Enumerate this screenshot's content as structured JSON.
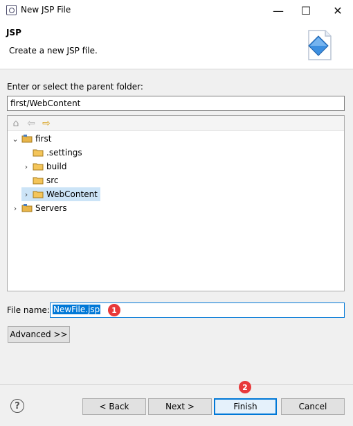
{
  "window": {
    "title": "New JSP File",
    "minimize": "—",
    "maximize": "☐",
    "close": "✕"
  },
  "header": {
    "title": "JSP",
    "description": "Create a new JSP file."
  },
  "folder": {
    "label": "Enter or select the parent folder:",
    "value": "first/WebContent"
  },
  "tree": {
    "toolbar": {
      "home": "⌂",
      "back": "⇦",
      "forward": "⇨"
    },
    "items": [
      {
        "label": "first",
        "expanded": true
      },
      {
        "label": ".settings"
      },
      {
        "label": "build"
      },
      {
        "label": "src"
      },
      {
        "label": "WebContent",
        "selected": true
      },
      {
        "label": "Servers"
      }
    ]
  },
  "file_name": {
    "label": "File name:",
    "value": "NewFile.jsp"
  },
  "buttons": {
    "advanced": "Advanced >>",
    "back": "< Back",
    "next": "Next >",
    "finish": "Finish",
    "cancel": "Cancel",
    "help": "?"
  },
  "annotations": {
    "badge1": "1",
    "badge2": "2"
  },
  "colors": {
    "accent": "#0078d7",
    "badge": "#e8393a",
    "folder": "#e8b54a"
  }
}
